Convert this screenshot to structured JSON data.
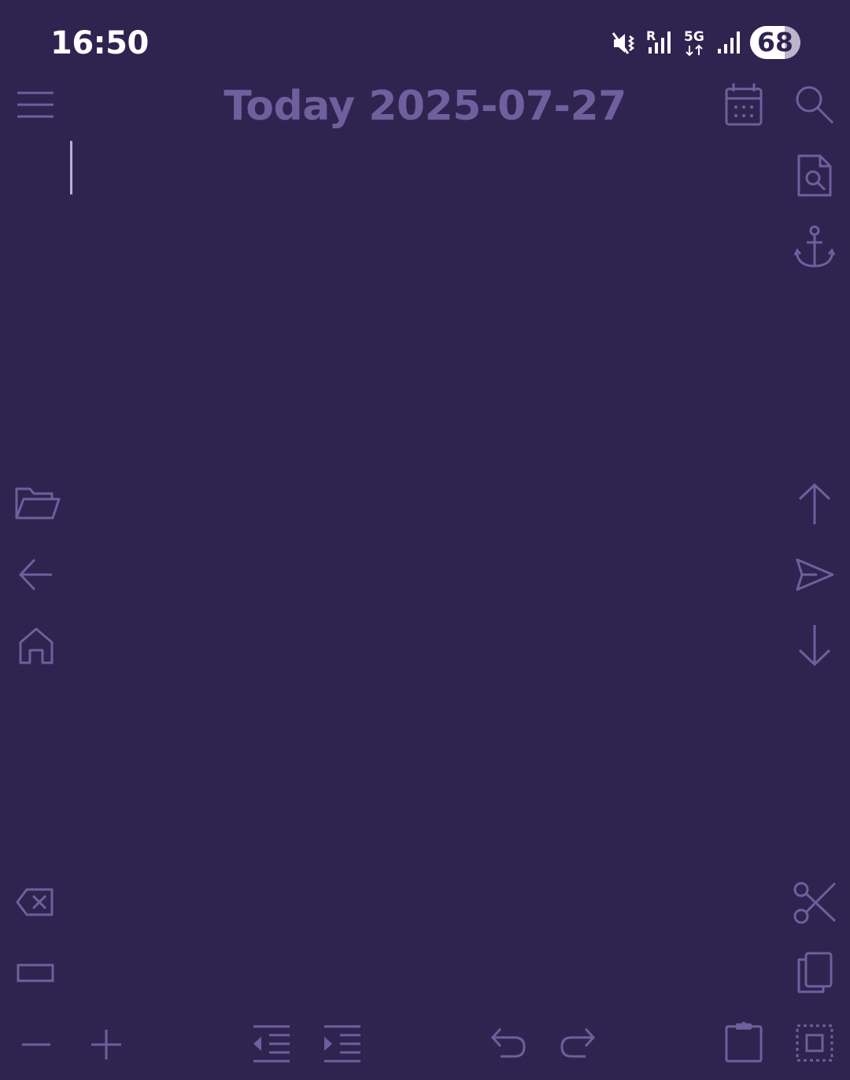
{
  "status_bar": {
    "time": "16:50",
    "network_label": "5G",
    "roaming_label": "R",
    "battery_level": 68,
    "battery_text": "68",
    "icons": [
      "vibrate-mute-icon",
      "roaming-signal-icon",
      "5g-data-icon",
      "signal-icon",
      "battery-icon"
    ]
  },
  "header": {
    "title": "Today 2025-07-27"
  },
  "colors": {
    "background": "#2f2350",
    "icon": "#6f5f9c",
    "cursor": "#b8aedc",
    "status_text": "#ffffff"
  },
  "toolbar_icons": {
    "top_left": [
      "menu-icon"
    ],
    "top_right": [
      "calendar-icon",
      "search-icon",
      "search-document-icon",
      "anchor-icon"
    ],
    "left_column": [
      "folder-open-icon",
      "arrow-left-icon",
      "home-icon",
      "backspace-icon",
      "space-bar-icon"
    ],
    "right_column": [
      "arrow-up-icon",
      "send-icon",
      "arrow-down-icon",
      "cut-icon",
      "copy-icon"
    ],
    "bottom_row": [
      "zoom-out-icon",
      "zoom-in-icon",
      "outdent-icon",
      "indent-icon",
      "undo-icon",
      "redo-icon",
      "paste-icon",
      "select-all-icon"
    ]
  }
}
